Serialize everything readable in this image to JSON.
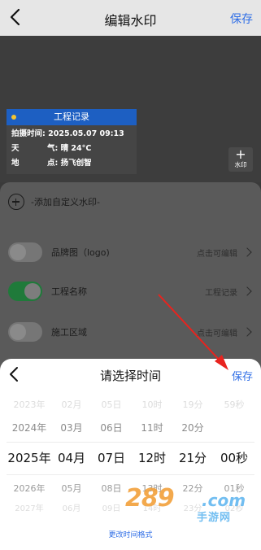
{
  "header": {
    "title": "编辑水印",
    "save_label": "保存"
  },
  "watermark": {
    "title": "工程记录",
    "rows": [
      {
        "key": "拍摄时间:",
        "value": "2025.05.07 09:13"
      },
      {
        "key": "天",
        "key2": "气:",
        "value": "晴 24°C"
      },
      {
        "key": "地",
        "key2": "点:",
        "value": "扬飞创智"
      }
    ],
    "add_button": {
      "plus": "+",
      "label": "水印"
    }
  },
  "settings": {
    "add_custom_label": "-添加自定义水印-",
    "items": [
      {
        "label": "品牌图（logo)",
        "value": "点击可编辑",
        "on": false
      },
      {
        "label": "工程名称",
        "value": "工程记录",
        "on": true
      },
      {
        "label": "施工区域",
        "value": "点击可编辑",
        "on": false
      }
    ]
  },
  "picker": {
    "title": "请选择时间",
    "save_label": "保存",
    "columns": [
      [
        "2023年",
        "2024年",
        "2025年",
        "2026年",
        "2027年"
      ],
      [
        "02月",
        "03月",
        "04月",
        "05月",
        "06月"
      ],
      [
        "05日",
        "06日",
        "07日",
        "08日",
        "09日"
      ],
      [
        "10时",
        "11时",
        "12时",
        "13时",
        "14时"
      ],
      [
        "19分",
        "20分",
        "21分",
        "22分",
        "23分"
      ],
      [
        "59秒",
        "",
        "00秒",
        "01秒",
        "02秒"
      ]
    ],
    "format_link": "更改时间格式"
  },
  "site_logo": {
    "number": "289",
    "domain": ".com",
    "name": "手游网"
  },
  "colors": {
    "accent": "#2f6ee6",
    "toggle_on": "#1f7a3a",
    "watermark_header": "#1d5fc2",
    "annotation": "#e8231e"
  }
}
